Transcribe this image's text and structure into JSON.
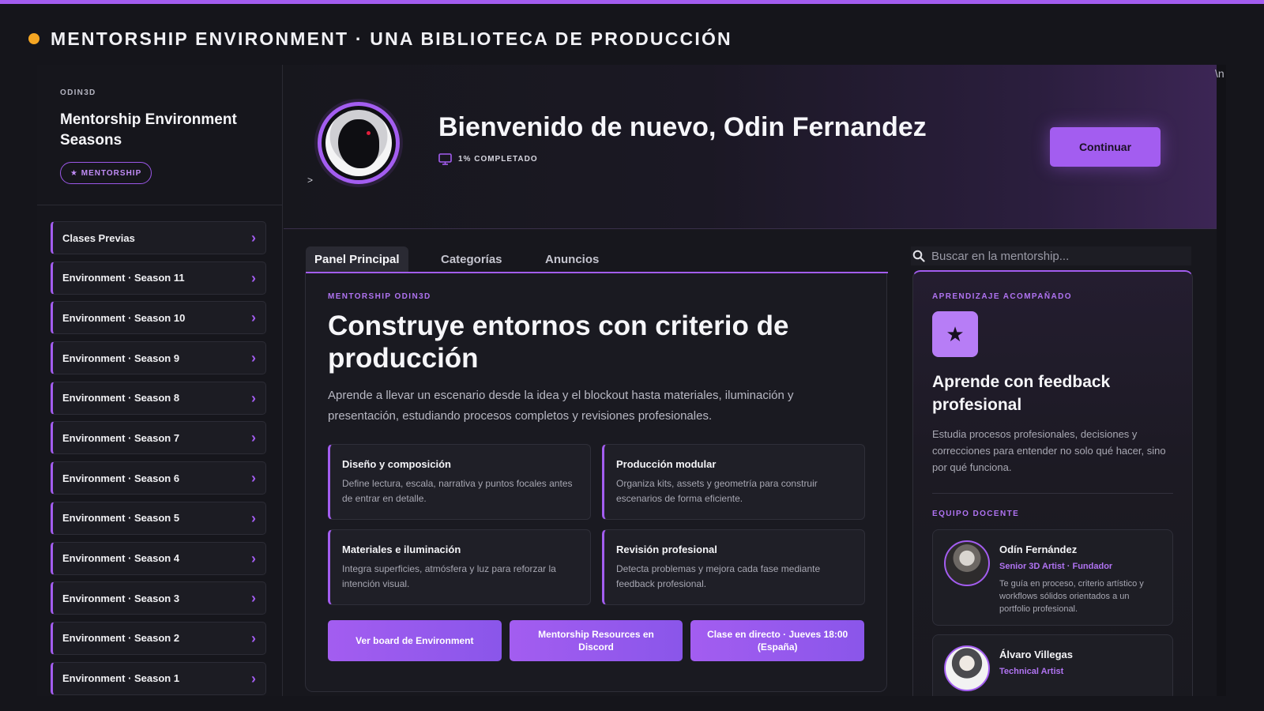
{
  "colors": {
    "accent": "#a35df0",
    "dot": "#f5a623",
    "background": "#15151b"
  },
  "page_header": {
    "title": "MENTORSHIP ENVIRONMENT · UNA BIBLIOTECA DE PRODUCCIÓN"
  },
  "stray_text": "\\n",
  "sidebar": {
    "brand": "ODIN3D",
    "course_title": "Mentorship Environment Seasons",
    "badge": "★ MENTORSHIP",
    "items": [
      {
        "label": "Clases Previas"
      },
      {
        "label": "Environment · Season 11"
      },
      {
        "label": "Environment · Season 10"
      },
      {
        "label": "Environment · Season 9"
      },
      {
        "label": "Environment · Season 8"
      },
      {
        "label": "Environment · Season 7"
      },
      {
        "label": "Environment · Season 6"
      },
      {
        "label": "Environment · Season 5"
      },
      {
        "label": "Environment · Season 4"
      },
      {
        "label": "Environment · Season 3"
      },
      {
        "label": "Environment · Season 2"
      },
      {
        "label": "Environment · Season 1"
      }
    ]
  },
  "hero": {
    "caret": ">",
    "welcome": "Bienvenido de nuevo, Odin Fernandez",
    "progress": "1% COMPLETADO",
    "progress_value": 1,
    "continue_label": "Continuar"
  },
  "tabs": [
    {
      "label": "Panel Principal",
      "active": true
    },
    {
      "label": "Categorías"
    },
    {
      "label": "Anuncios"
    }
  ],
  "search": {
    "placeholder": "Buscar en la mentorship..."
  },
  "main": {
    "eyebrow": "MENTORSHIP ODIN3D",
    "title": "Construye entornos con criterio de producción",
    "description": "Aprende a llevar un escenario desde la idea y el blockout hasta materiales, iluminación y presentación, estudiando procesos completos y revisiones profesionales.",
    "features": [
      {
        "title": "Diseño y composición",
        "desc": "Define lectura, escala, narrativa y puntos focales antes de entrar en detalle."
      },
      {
        "title": "Producción modular",
        "desc": "Organiza kits, assets y geometría para construir escenarios de forma eficiente."
      },
      {
        "title": "Materiales e iluminación",
        "desc": "Integra superficies, atmósfera y luz para reforzar la intención visual."
      },
      {
        "title": "Revisión profesional",
        "desc": "Detecta problemas y mejora cada fase mediante feedback profesional."
      }
    ],
    "ctas": [
      {
        "label": "Ver board de Environment"
      },
      {
        "label": "Mentorship Resources en Discord"
      },
      {
        "label": "Clase en directo · Jueves 18:00 (España)"
      }
    ]
  },
  "right_panel": {
    "eyebrow": "APRENDIZAJE ACOMPAÑADO",
    "title": "Aprende con feedback profesional",
    "description": "Estudia procesos profesionales, decisiones y correcciones para entender no solo qué hacer, sino por qué funciona.",
    "team_label": "EQUIPO DOCENTE",
    "members": [
      {
        "name": "Odín Fernández",
        "role": "Senior 3D Artist · Fundador",
        "bio": "Te guía en proceso, criterio artístico y workflows sólidos orientados a un portfolio profesional."
      },
      {
        "name": "Álvaro Villegas",
        "role": "Technical Artist",
        "bio": ""
      }
    ]
  }
}
